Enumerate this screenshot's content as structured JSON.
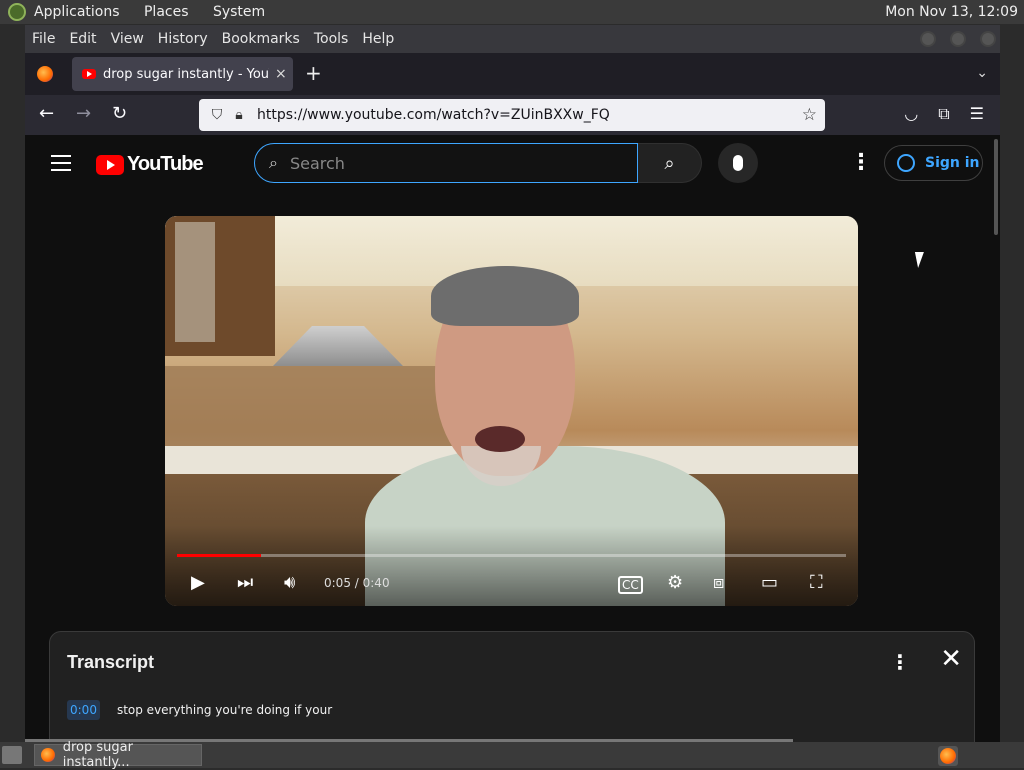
{
  "desktop": {
    "menu": [
      "Applications",
      "Places",
      "System"
    ],
    "clock": "Mon Nov 13, 12:09"
  },
  "browser": {
    "menubar": [
      "File",
      "Edit",
      "View",
      "History",
      "Bookmarks",
      "Tools",
      "Help"
    ],
    "tab": {
      "title": "drop sugar instantly - YouTube",
      "close": "×"
    },
    "newtab": "+",
    "url": "https://www.youtube.com/watch?v=ZUinBXXw_FQ"
  },
  "youtube": {
    "logo_text": "YouTube",
    "search_placeholder": "Search",
    "signin_label": "Sign in",
    "player": {
      "current_time": "0:05",
      "duration": "0:40",
      "progress_fraction": 0.125
    },
    "transcript": {
      "title": "Transcript",
      "segments": [
        {
          "timestamp": "0:00",
          "text": "stop everything you're doing if your"
        }
      ]
    }
  },
  "taskbar": {
    "task_label": "drop sugar instantly..."
  },
  "colors": {
    "youtube_red": "#ff0000",
    "link_blue": "#3ea6ff",
    "page_bg": "#0f0f0f"
  }
}
